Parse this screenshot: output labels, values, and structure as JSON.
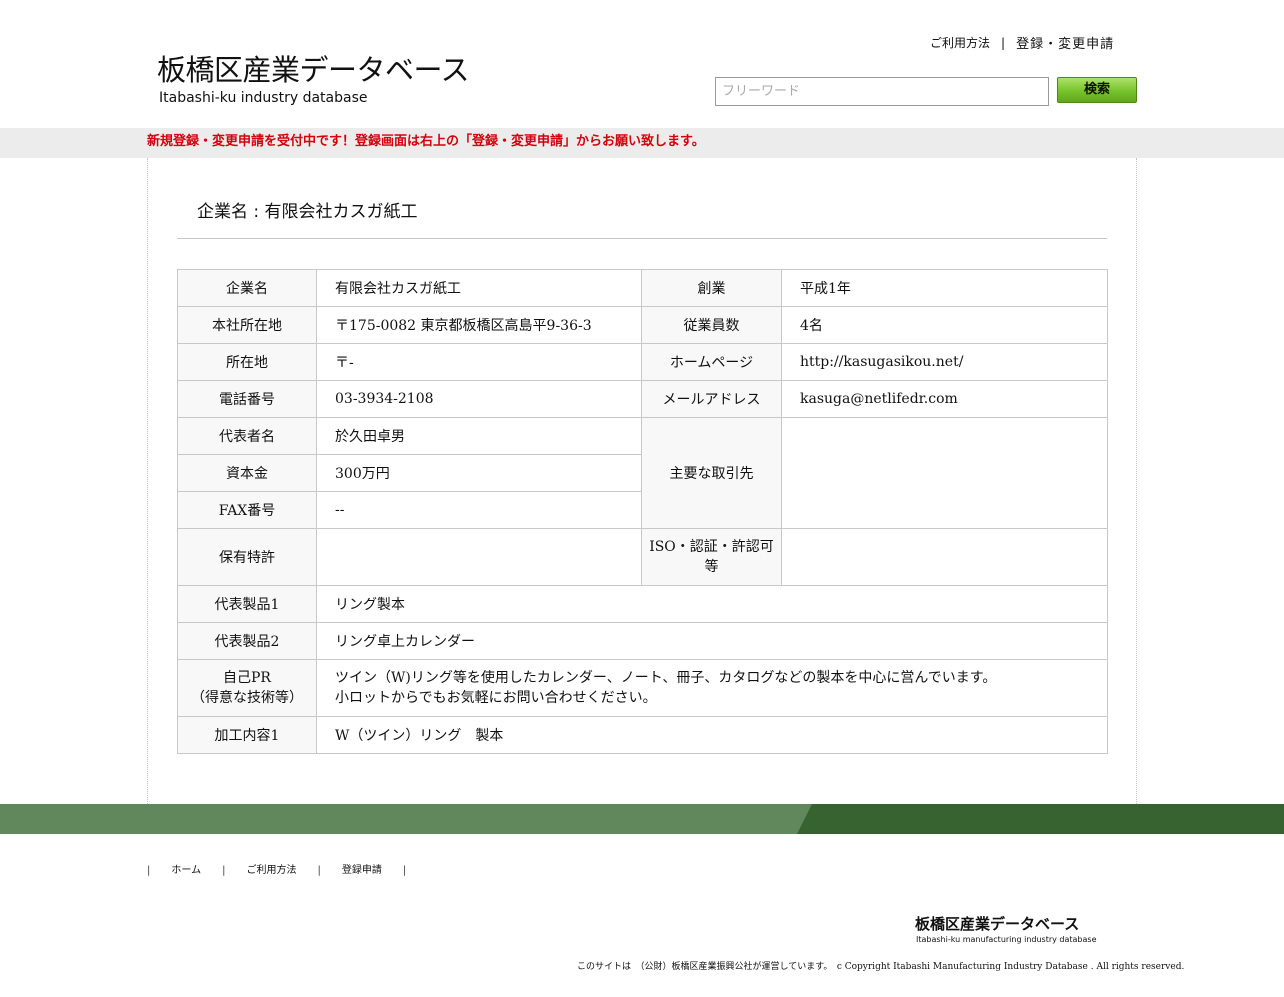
{
  "header": {
    "logo_title": "板橋区産業データベース",
    "logo_subtitle": "Itabashi-ku industry database",
    "link_usage": "ご利用方法",
    "link_separator": "|",
    "link_register": "登録・変更申請",
    "search_placeholder": "フリーワード",
    "search_button": "検索"
  },
  "notice": "新規登録・変更申請を受付中です！登録画面は右上の「登録・変更申請」からお願い致します。",
  "company": {
    "heading": "企業名 : 有限会社カスガ紙工",
    "rows": {
      "name_label": "企業名",
      "name_value": "有限会社カスガ紙工",
      "founded_label": "創業",
      "founded_value": "平成1年",
      "hq_label": "本社所在地",
      "hq_value": "〒175-0082 東京都板橋区高島平9-36-3",
      "employees_label": "従業員数",
      "employees_value": "4名",
      "location_label": "所在地",
      "location_value": "〒-",
      "homepage_label": "ホームページ",
      "homepage_value": "http://kasugasikou.net/",
      "phone_label": "電話番号",
      "phone_value": "03-3934-2108",
      "email_label": "メールアドレス",
      "email_value": "kasuga@netlifedr.com",
      "rep_label": "代表者名",
      "rep_value": "於久田卓男",
      "partners_label": "主要な取引先",
      "partners_value": "",
      "capital_label": "資本金",
      "capital_value": "300万円",
      "fax_label": "FAX番号",
      "fax_value": "--",
      "patent_label": "保有特許",
      "patent_value": "",
      "iso_label": "ISO・認証・許認可等",
      "iso_value": "",
      "product1_label": "代表製品1",
      "product1_value": "リング製本",
      "product2_label": "代表製品2",
      "product2_value": "リング卓上カレンダー",
      "pr_label_line1": "自己PR",
      "pr_label_line2": "（得意な技術等）",
      "pr_value_line1": "ツイン（W)リング等を使用したカレンダー、ノート、冊子、カタログなどの製本を中心に営んでいます。",
      "pr_value_line2": "小ロットからでもお気軽にお問い合わせください。",
      "process1_label": "加工内容1",
      "process1_value": "W（ツイン）リング　製本"
    }
  },
  "footer": {
    "nav": [
      "ホーム",
      "ご利用方法",
      "登録申請"
    ],
    "nav_separator": "|",
    "logo_title": "板橋区産業データベース",
    "logo_subtitle": "Itabashi-ku manufacturing industry database",
    "copyright": "このサイトは　（公財）板橋区産業振興公社が運営しています。　c Copyright Itabashi Manufacturing Industry Database . All rights reserved."
  },
  "colors": {
    "notice_red": "#d4000c",
    "footer_green_light": "#61875c",
    "footer_green_dark": "#36632f",
    "search_button_green": "#77c22c"
  }
}
